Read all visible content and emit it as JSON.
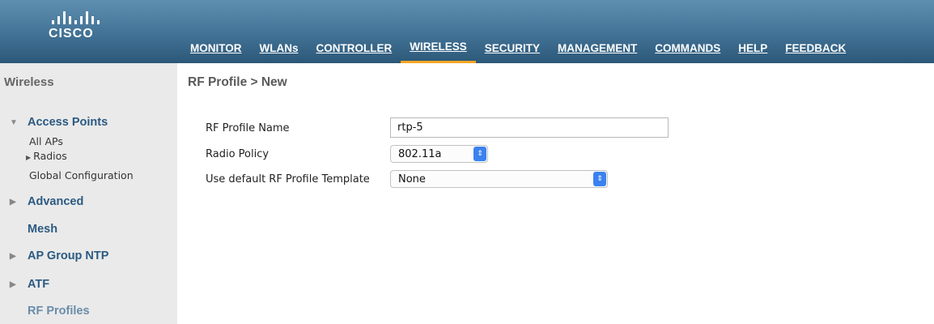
{
  "header": {
    "logo_text": "CISCO",
    "nav": [
      {
        "label": "MONITOR"
      },
      {
        "label": "WLANs"
      },
      {
        "label": "CONTROLLER"
      },
      {
        "label": "WIRELESS",
        "active": true
      },
      {
        "label": "SECURITY"
      },
      {
        "label": "MANAGEMENT"
      },
      {
        "label": "COMMANDS"
      },
      {
        "label": "HELP"
      },
      {
        "label": "FEEDBACK"
      }
    ],
    "active_underline_color": "#f5a623"
  },
  "sidebar": {
    "title": "Wireless",
    "access_points": "Access Points",
    "all_aps": "All APs",
    "radios": "Radios",
    "global_configuration": "Global Configuration",
    "advanced": "Advanced",
    "mesh": "Mesh",
    "ap_group_ntp": "AP Group NTP",
    "atf": "ATF",
    "rf_profiles": "RF Profiles"
  },
  "main": {
    "title": "RF Profile > New",
    "profile_name_label": "RF Profile Name",
    "profile_name_value": "rtp-5",
    "radio_policy_label": "Radio Policy",
    "radio_policy_value": "802.11a",
    "template_label": "Use default RF Profile Template",
    "template_value": "None"
  }
}
